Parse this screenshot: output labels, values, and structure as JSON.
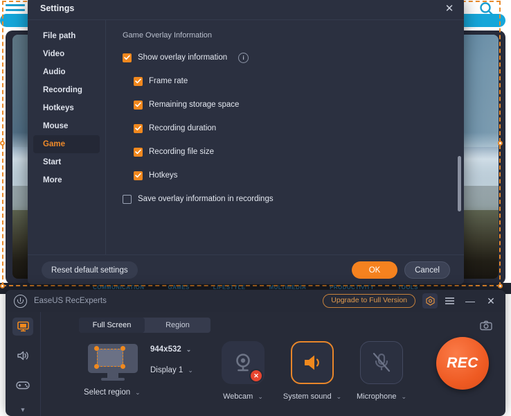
{
  "background": {
    "hamburger_icon": "hamburger-menu-icon",
    "search_icon": "search-icon",
    "categories": [
      "COMMUNICATION",
      "GAMES",
      "LIFESTYLE",
      "MULTIMEDIA",
      "PRODUCTIVITY",
      "TOOLS"
    ]
  },
  "settings": {
    "title": "Settings",
    "close_label": "✕",
    "sidebar": [
      {
        "label": "File path",
        "selected": false
      },
      {
        "label": "Video",
        "selected": false
      },
      {
        "label": "Audio",
        "selected": false
      },
      {
        "label": "Recording",
        "selected": false
      },
      {
        "label": "Hotkeys",
        "selected": false
      },
      {
        "label": "Mouse",
        "selected": false
      },
      {
        "label": "Game",
        "selected": true
      },
      {
        "label": "Start",
        "selected": false
      },
      {
        "label": "More",
        "selected": false
      }
    ],
    "section_heading": "Game Overlay Information",
    "options": [
      {
        "label": "Show overlay information",
        "checked": true,
        "indent": false,
        "info": true
      },
      {
        "label": "Frame rate",
        "checked": true,
        "indent": true,
        "info": false
      },
      {
        "label": "Remaining storage space",
        "checked": true,
        "indent": true,
        "info": false
      },
      {
        "label": "Recording duration",
        "checked": true,
        "indent": true,
        "info": false
      },
      {
        "label": "Recording file size",
        "checked": true,
        "indent": true,
        "info": false
      },
      {
        "label": "Hotkeys",
        "checked": true,
        "indent": true,
        "info": false
      },
      {
        "label": "Save overlay information in recordings",
        "checked": false,
        "indent": false,
        "info": false
      }
    ],
    "info_icon_char": "i",
    "footer": {
      "reset_label": "Reset default settings",
      "ok_label": "OK",
      "cancel_label": "Cancel"
    },
    "accent_color": "#f5821f",
    "panel_color": "#2b3040"
  },
  "recexperts": {
    "app_name": "EaseUS RecExperts",
    "logo_icon": "recexperts-logo-icon",
    "upgrade_label": "Upgrade to Full Version",
    "hex_icon": "hexagon-settings-icon",
    "menu_icon": "hamburger-menu-icon",
    "minimize_label": "—",
    "close_label": "✕",
    "screenshot_icon": "camera-icon",
    "rail": [
      {
        "icon": "monitor-icon",
        "active": true
      },
      {
        "icon": "speaker-icon",
        "active": false
      },
      {
        "icon": "gamepad-icon",
        "active": false
      },
      {
        "icon": "chevron-down-icon",
        "active": false
      }
    ],
    "tabs": [
      {
        "label": "Full Screen",
        "selected": true
      },
      {
        "label": "Region",
        "selected": false
      }
    ],
    "monitor_icon": "monitor-region-icon",
    "resolution": "944x532",
    "display": "Display 1",
    "select_region_label": "Select region",
    "chevron_char": "⌄",
    "devices": [
      {
        "label": "Webcam",
        "icon": "webcam-icon",
        "state": "disabled"
      },
      {
        "label": "System sound",
        "icon": "speaker-on-icon",
        "state": "enabled"
      },
      {
        "label": "Microphone",
        "icon": "microphone-muted-icon",
        "state": "muted"
      }
    ],
    "rec_label": "REC",
    "accent_color": "#f0891e",
    "rec_color": "#ee5a22"
  }
}
